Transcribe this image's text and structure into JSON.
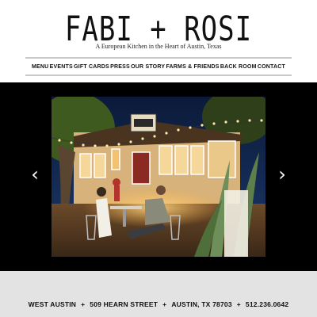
{
  "brand": {
    "logo": "FABI + ROSI",
    "tagline": "A European Kitchen in the Heart of Austin, Texas"
  },
  "nav": {
    "items": [
      {
        "label": "MENU"
      },
      {
        "label": "EVENTS"
      },
      {
        "label": "GIFT CARDS"
      },
      {
        "label": "PRESS"
      },
      {
        "label": "OUR STORY"
      },
      {
        "label": "FARMS & FRIENDS"
      },
      {
        "label": "BACK ROOM"
      },
      {
        "label": "CONTACT"
      }
    ]
  },
  "slider": {
    "prev_icon": "chevron-left-icon",
    "next_icon": "chevron-right-icon",
    "prev_glyph": "‹",
    "next_glyph": "›",
    "image": "restaurant-patio-night-photo"
  },
  "footer": {
    "neighborhood": "WEST AUSTIN",
    "street": "509 HEARN STREET",
    "city": "AUSTIN, TX 78703",
    "phone": "512.236.0642",
    "separator": "+"
  },
  "colors": {
    "nav_rule": "#c9c9c9",
    "slider_bg": "#000000",
    "footer_bg": "#e3e3e3"
  }
}
